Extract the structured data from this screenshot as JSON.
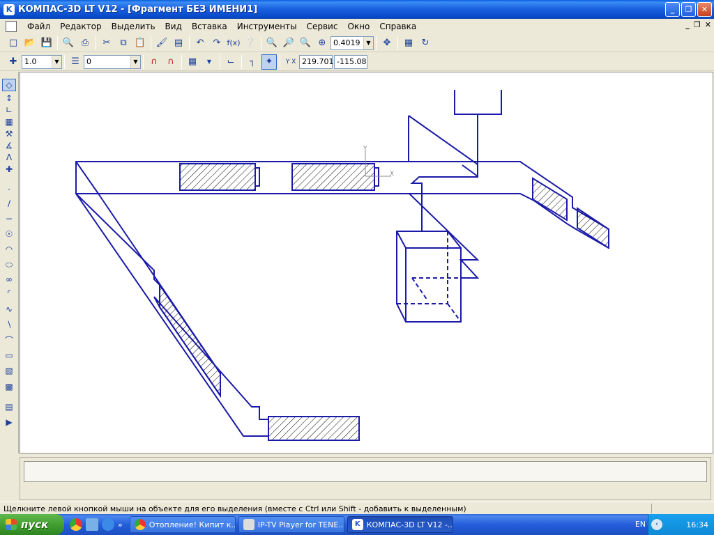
{
  "window": {
    "title": "КОМПАС-3D LT V12 - [Фрагмент БЕЗ ИМЕНИ1]",
    "minimize": "_",
    "maximize": "❐",
    "close": "✕"
  },
  "menu": {
    "items": [
      "Файл",
      "Редактор",
      "Выделить",
      "Вид",
      "Вставка",
      "Инструменты",
      "Сервис",
      "Окно",
      "Справка"
    ],
    "mdi_min": "_",
    "mdi_restore": "❐",
    "mdi_close": "✕"
  },
  "toolbar1": {
    "zoom_value": "0.4019"
  },
  "toolbar2": {
    "step_value": "1.0",
    "layer_value": "0",
    "coord_x": "219.701",
    "coord_y": "-115.08",
    "coord_label": "Y X"
  },
  "drawing": {
    "axis_y": "Y",
    "axis_x": "X",
    "line_color": "#1a1aa8"
  },
  "status": {
    "hint": "Щелкните левой кнопкой мыши на объекте для его выделения (вместе с Ctrl или Shift - добавить к выделенным)"
  },
  "taskbar": {
    "start": "пуск",
    "tasks": [
      "Отопление! Кипит к...",
      "IP-TV Player for TENE...",
      "КОМПАС-3D LT V12 -..."
    ],
    "language": "EN",
    "time": "16:34"
  }
}
